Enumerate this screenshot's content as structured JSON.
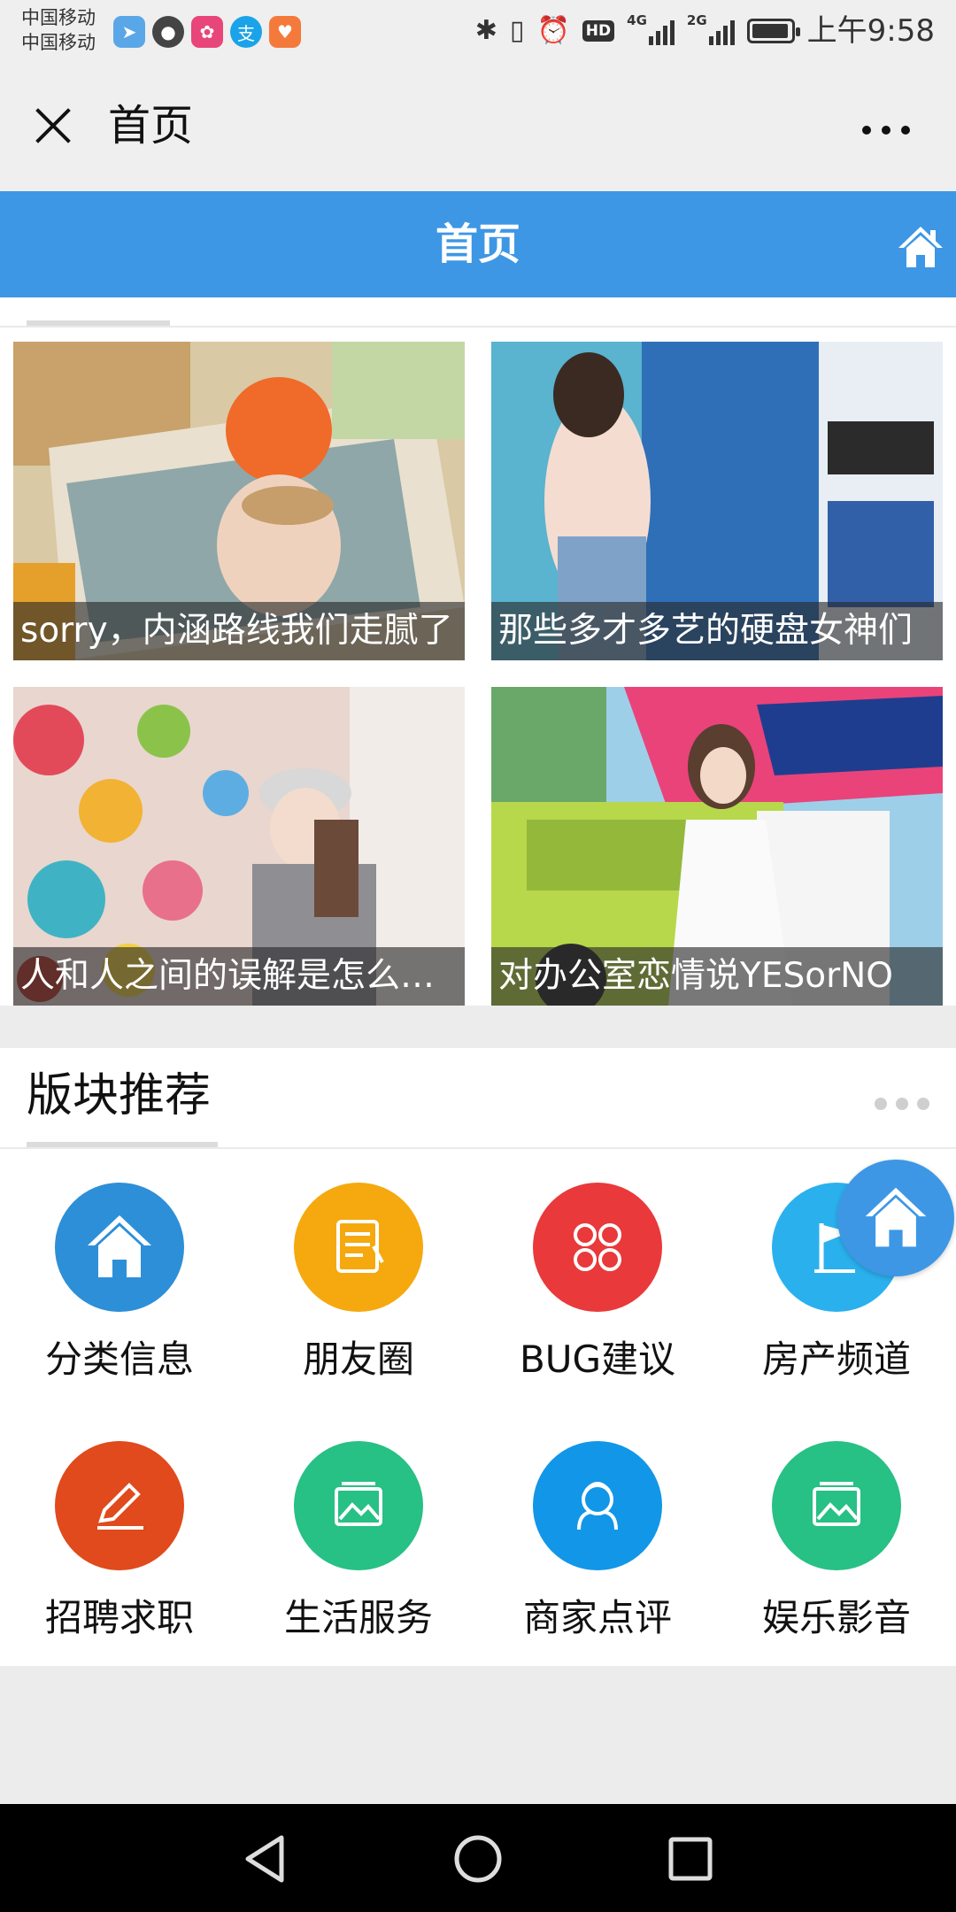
{
  "status_bar": {
    "carrier_line1": "中国移动",
    "carrier_line2": "中国移动",
    "network_4g": "4G",
    "network_2g": "2G",
    "hd": "HD",
    "time": "上午9:58"
  },
  "wechat_header": {
    "title": "首页"
  },
  "page_bar": {
    "title": "首页",
    "accent": "#3d97e5"
  },
  "articles": [
    {
      "title": "sorry，内涵路线我们走腻了"
    },
    {
      "title": "那些多才多艺的硬盘女神们"
    },
    {
      "title": "人和人之间的误解是怎么来的"
    },
    {
      "title": "对办公室恋情说YESorNO"
    }
  ],
  "section": {
    "title": "版块推荐",
    "items": [
      {
        "label": "分类信息",
        "color": "#2d8fd8",
        "icon": "home-icon"
      },
      {
        "label": "朋友圈",
        "color": "#f5a90f",
        "icon": "notes-icon"
      },
      {
        "label": "BUG建议",
        "color": "#e9393a",
        "icon": "clover-icon"
      },
      {
        "label": "房产频道",
        "color": "#2bb0ee",
        "icon": "flag-icon"
      },
      {
        "label": "招聘求职",
        "color": "#e04a1c",
        "icon": "pencil-icon"
      },
      {
        "label": "生活服务",
        "color": "#27c085",
        "icon": "picture-icon"
      },
      {
        "label": "商家点评",
        "color": "#1296e8",
        "icon": "person-icon"
      },
      {
        "label": "娱乐影音",
        "color": "#27c085",
        "icon": "picture-icon"
      }
    ]
  }
}
